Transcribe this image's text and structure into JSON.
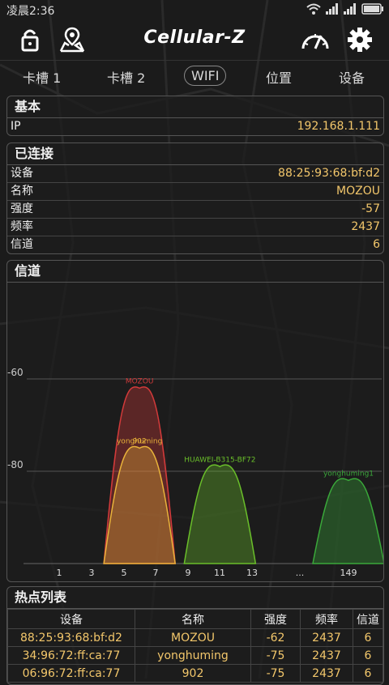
{
  "status": {
    "time": "凌晨2:36"
  },
  "app": {
    "title": "Cellular-Z"
  },
  "tabs": [
    "卡槽 1",
    "卡槽 2",
    "WIFI",
    "位置",
    "设备"
  ],
  "basic": {
    "header": "基本",
    "rows": [
      {
        "key": "IP",
        "value": "192.168.1.111"
      }
    ]
  },
  "connected": {
    "header": "已连接",
    "rows": [
      {
        "key": "设备",
        "value": "88:25:93:68:bf:d2"
      },
      {
        "key": "名称",
        "value": "MOZOU"
      },
      {
        "key": "强度",
        "value": "-57"
      },
      {
        "key": "频率",
        "value": "2437"
      },
      {
        "key": "信道",
        "value": "6"
      }
    ]
  },
  "channel": {
    "header": "信道"
  },
  "chart_data": {
    "type": "area",
    "title": "信道",
    "y_ticks": [
      -60,
      -80
    ],
    "x_ticks": [
      "1",
      "3",
      "5",
      "7",
      "9",
      "11",
      "13",
      "...",
      "149"
    ],
    "series": [
      {
        "name": "MOZOU",
        "channel": 6,
        "level": -62,
        "color": "#d13a3a"
      },
      {
        "name": "yonghuming",
        "channel": 6,
        "level": -75,
        "color": "#e8b23a"
      },
      {
        "name": "902",
        "channel": 6,
        "level": -75,
        "color": "#e8b23a"
      },
      {
        "name": "HUAWEI-B315-BF72",
        "channel": 11,
        "level": -79,
        "color": "#6abf2a"
      },
      {
        "name": "yonghuming1",
        "channel": 149,
        "level": -82,
        "color": "#3aa83a"
      }
    ]
  },
  "hotspots": {
    "header": "热点列表",
    "columns": [
      "设备",
      "名称",
      "强度",
      "频率",
      "信道"
    ],
    "rows": [
      [
        "88:25:93:68:bf:d2",
        "MOZOU",
        "-62",
        "2437",
        "6"
      ],
      [
        "34:96:72:ff:ca:77",
        "yonghuming",
        "-75",
        "2437",
        "6"
      ],
      [
        "06:96:72:ff:ca:77",
        "902",
        "-75",
        "2437",
        "6"
      ]
    ]
  }
}
